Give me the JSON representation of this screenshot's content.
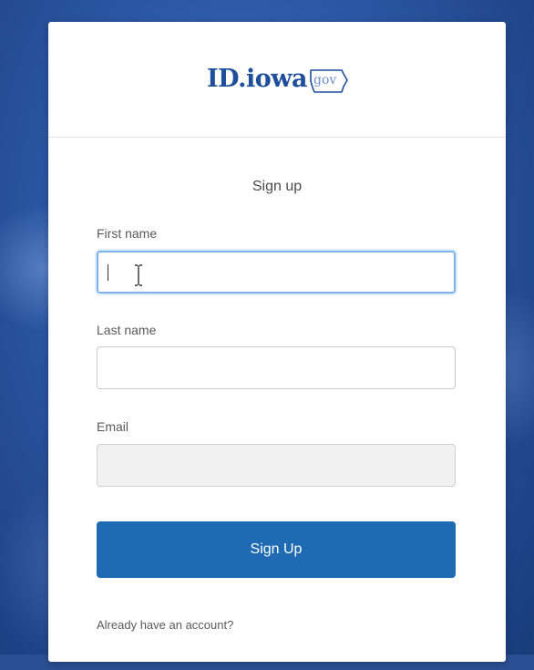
{
  "logo": {
    "main_text": "ID.iowa",
    "suffix_text": "gov",
    "brand_color": "#1f4f9c"
  },
  "form": {
    "title": "Sign up",
    "first_name": {
      "label": "First name",
      "value": "",
      "state": "focused"
    },
    "last_name": {
      "label": "Last name",
      "value": ""
    },
    "email": {
      "label": "Email",
      "value": "",
      "state": "disabled"
    },
    "submit_label": "Sign Up",
    "submit_color": "#1e6ab3",
    "account_link": "Already have an account?"
  },
  "icons": {
    "text_cursor": "i-beam-cursor-icon"
  }
}
